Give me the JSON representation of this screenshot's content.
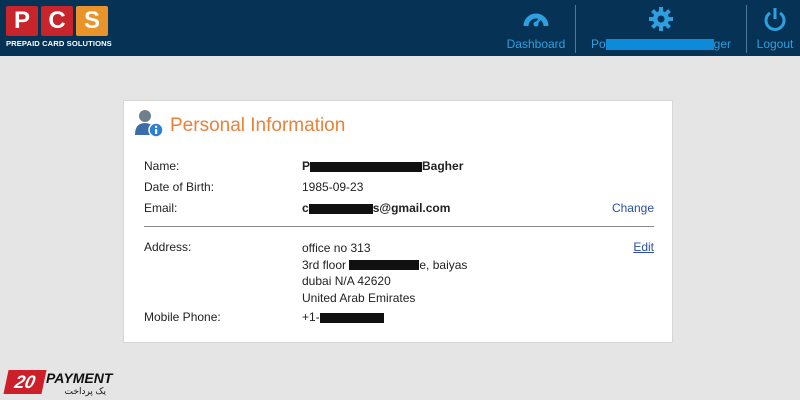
{
  "header": {
    "logo": {
      "letters": [
        "P",
        "C",
        "S"
      ],
      "subtitle": "PREPAID CARD SOLUTIONS"
    },
    "nav": {
      "dashboard_label": "Dashboard",
      "profile_label_start": "Po",
      "profile_label_end": "ger",
      "logout_label": "Logout"
    },
    "colors": {
      "background": "#063355",
      "nav_accent": "#2f9fe0"
    }
  },
  "card": {
    "title": "Personal Information",
    "icon": "user-info-icon",
    "name": {
      "label": "Name:",
      "value_start": "P",
      "value_end": "Bagher"
    },
    "dob": {
      "label": "Date of Birth:",
      "value": "1985-09-23"
    },
    "email": {
      "label": "Email:",
      "value_start": "c",
      "value_end": "s@gmail.com",
      "action": "Change"
    },
    "address": {
      "label": "Address:",
      "line1": "office no 313",
      "line2_start": "3rd floor",
      "line2_end": "e, baiyas",
      "line3": "dubai N/A 42620",
      "line4": "United Arab Emirates",
      "action": "Edit"
    },
    "mobile": {
      "label": "Mobile Phone:",
      "value_start": "+1-"
    },
    "colors": {
      "title": "#e8823a",
      "link": "#2a4ea8"
    }
  },
  "watermark": {
    "badge": "20",
    "title": "PAYMENT",
    "subtitle": "یک پرداخت خوب"
  }
}
